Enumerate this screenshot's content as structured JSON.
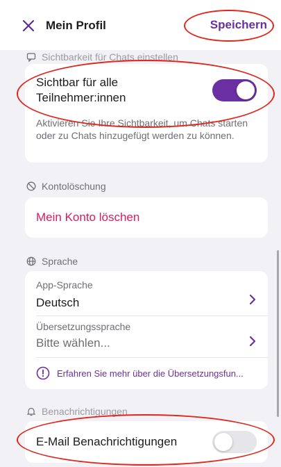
{
  "header": {
    "close_icon": "close-icon",
    "title": "Mein Profil",
    "save_label": "Speichern"
  },
  "visibility": {
    "section_label": "Sichtbarkeit für Chats einstellen",
    "toggle_label_line1": "Sichtbar für alle",
    "toggle_label_line2": "Teilnehmer:innen",
    "toggle_state": true,
    "description": "Aktivieren Sie Ihre Sichtbarkeit, um Chats starten oder zu Chats hinzugefügt werden zu können."
  },
  "account_deletion": {
    "section_label": "Kontolöschung",
    "delete_label": "Mein Konto löschen"
  },
  "language": {
    "section_label": "Sprache",
    "app_language_label": "App-Sprache",
    "app_language_value": "Deutsch",
    "translation_language_label": "Übersetzungssprache",
    "translation_language_value": "Bitte wählen...",
    "info_text": "Erfahren Sie mehr über die Übersetzungsfun..."
  },
  "notifications": {
    "section_label": "Benachrichtigungen",
    "email_label": "E-Mail Benachrichtigungen",
    "email_toggle_state": false
  },
  "colors": {
    "accent": "#6a2fa0",
    "danger": "#d81b60",
    "annotation": "#e0261b"
  }
}
